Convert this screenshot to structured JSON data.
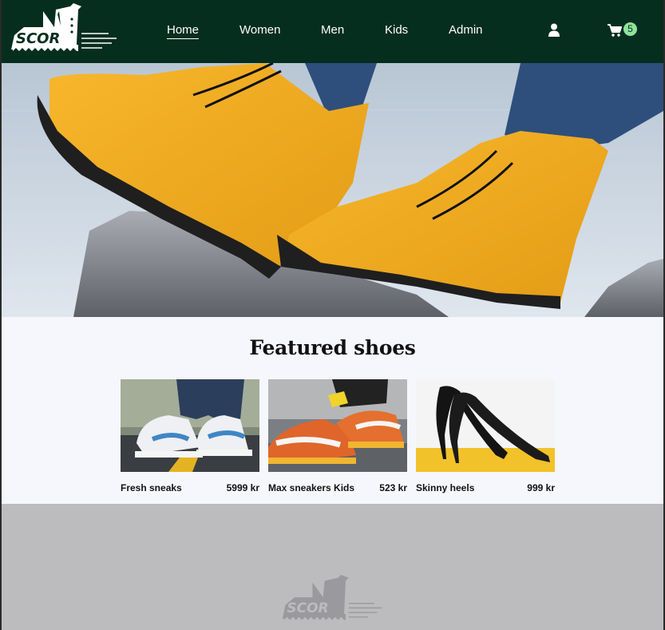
{
  "brand": {
    "logo_text": "SCOR",
    "colors": {
      "header_bg": "#062e1f",
      "badge_bg": "#8fe39a",
      "footer_bg": "#bcbcbf",
      "page_bg": "#f6f7fc"
    }
  },
  "nav": {
    "items": [
      {
        "label": "Home",
        "active": true
      },
      {
        "label": "Women",
        "active": false
      },
      {
        "label": "Men",
        "active": false
      },
      {
        "label": "Kids",
        "active": false
      },
      {
        "label": "Admin",
        "active": false
      }
    ],
    "user_icon": "user-icon",
    "cart_icon": "shopping-cart-icon",
    "cart_count": "5"
  },
  "hero": {
    "image": "yellow-boots-on-rock"
  },
  "featured": {
    "title": "Featured shoes",
    "products": [
      {
        "name": "Fresh sneaks",
        "price": "5999 kr",
        "image": "white-blue-high-top-sneakers"
      },
      {
        "name": "Max sneakers Kids",
        "price": "523 kr",
        "image": "orange-air-max-sneakers"
      },
      {
        "name": "Skinny heels",
        "price": "999 kr",
        "image": "black-stiletto-heels"
      }
    ]
  }
}
